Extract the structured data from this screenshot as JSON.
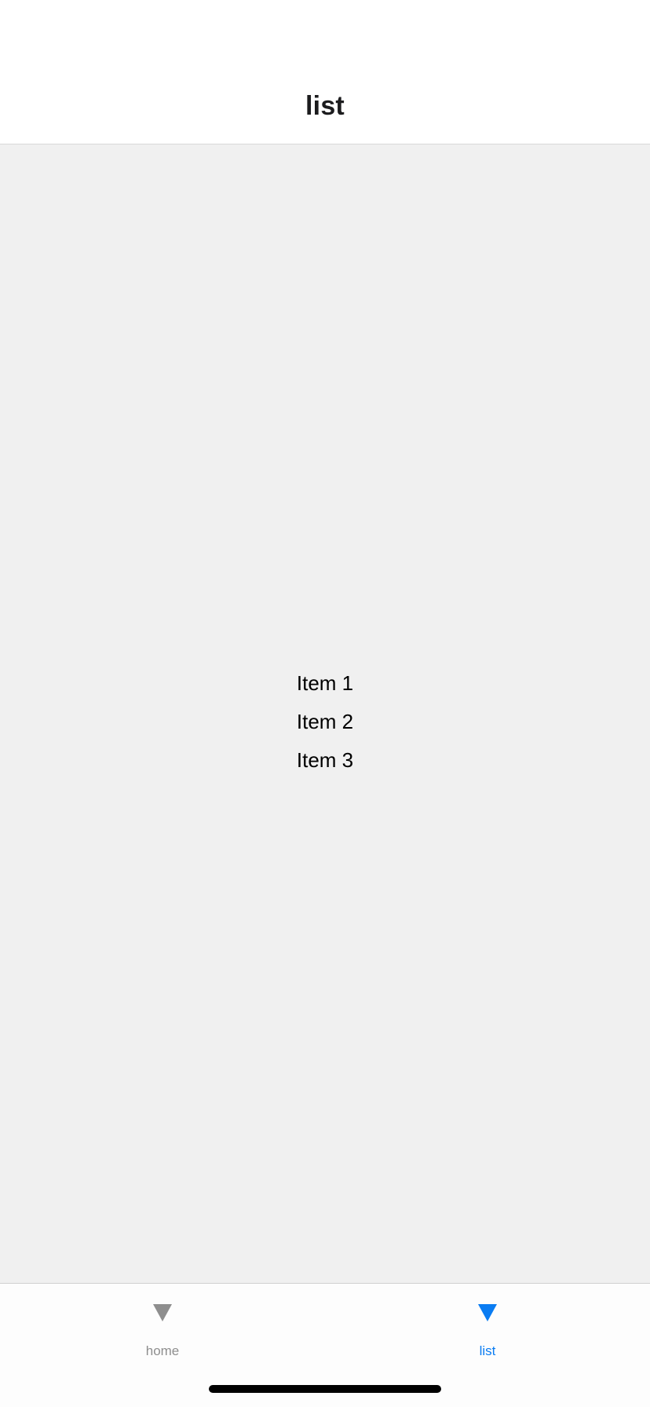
{
  "header": {
    "title": "list"
  },
  "list": {
    "items": [
      "Item 1",
      "Item 2",
      "Item 3"
    ]
  },
  "tabbar": {
    "tabs": [
      {
        "label": "home",
        "icon": "triangle-down-icon",
        "active": false,
        "color": "#8e8e8e"
      },
      {
        "label": "list",
        "icon": "triangle-down-icon",
        "active": true,
        "color": "#0a7cf2"
      }
    ]
  },
  "colors": {
    "content_background": "#f0f0f0",
    "accent": "#0a7cf2",
    "inactive": "#8e8e8e"
  }
}
